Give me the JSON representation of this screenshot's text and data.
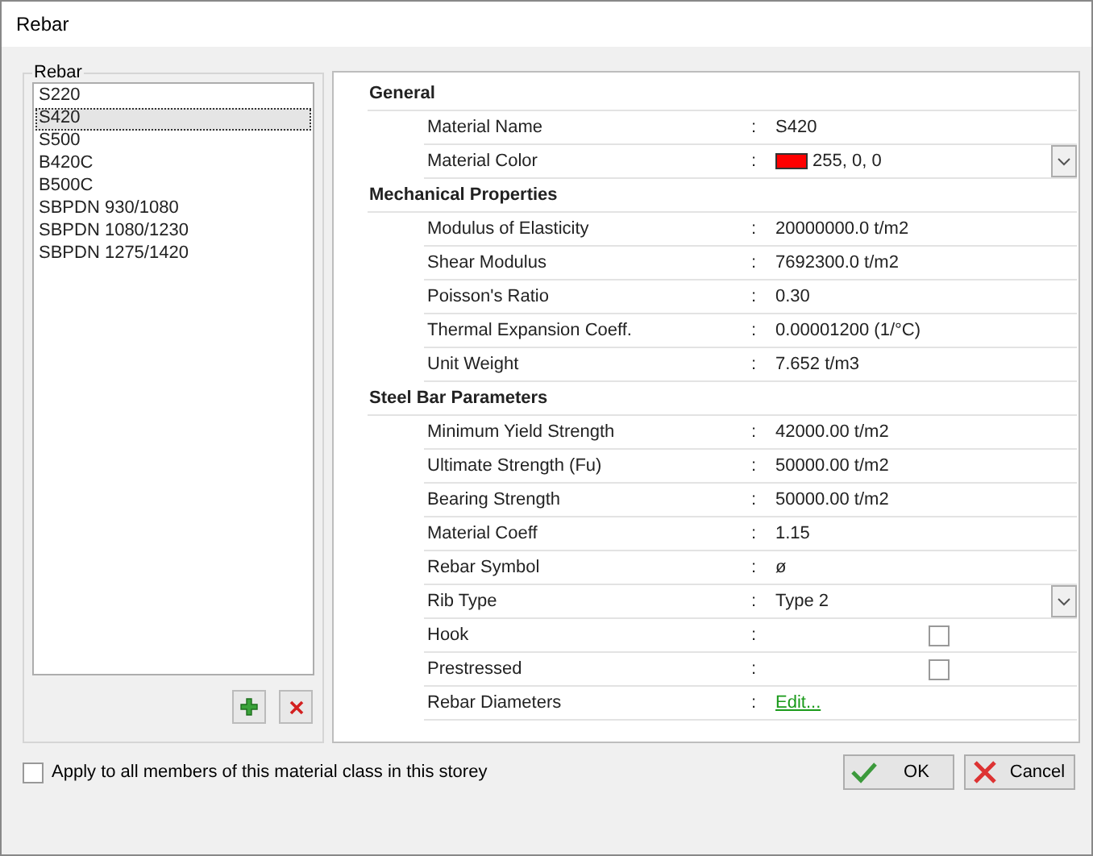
{
  "window": {
    "title": "Rebar"
  },
  "rebar_list": {
    "label": "Rebar",
    "items": [
      {
        "name": "S220",
        "selected": false
      },
      {
        "name": "S420",
        "selected": true
      },
      {
        "name": "S500",
        "selected": false
      },
      {
        "name": "B420C",
        "selected": false
      },
      {
        "name": "B500C",
        "selected": false
      },
      {
        "name": "SBPDN 930/1080",
        "selected": false
      },
      {
        "name": "SBPDN 1080/1230",
        "selected": false
      },
      {
        "name": "SBPDN 1275/1420",
        "selected": false
      }
    ]
  },
  "properties": {
    "sections": [
      {
        "title": "General",
        "rows": [
          {
            "kind": "text",
            "label": "Material Name",
            "separator": ":",
            "value": "S420"
          },
          {
            "kind": "color",
            "label": "Material Color",
            "separator": ":",
            "value": "255, 0, 0",
            "color": "#ff0000"
          }
        ]
      },
      {
        "title": "Mechanical Properties",
        "rows": [
          {
            "kind": "text",
            "label": "Modulus of Elasticity",
            "separator": ":",
            "value": "20000000.0  t/m2"
          },
          {
            "kind": "text",
            "label": "Shear Modulus",
            "separator": ":",
            "value": "7692300.0  t/m2"
          },
          {
            "kind": "text",
            "label": "Poisson's Ratio",
            "separator": ":",
            "value": "0.30"
          },
          {
            "kind": "text",
            "label": "Thermal Expansion Coeff.",
            "separator": ":",
            "value": "0.00001200  (1/°C)"
          },
          {
            "kind": "text",
            "label": "Unit Weight",
            "separator": ":",
            "value": "7.652  t/m3"
          }
        ]
      },
      {
        "title": "Steel Bar Parameters",
        "rows": [
          {
            "kind": "text",
            "label": "Minimum Yield Strength",
            "separator": ":",
            "value": "42000.00  t/m2"
          },
          {
            "kind": "text",
            "label": "Ultimate Strength (Fu)",
            "separator": ":",
            "value": "50000.00  t/m2"
          },
          {
            "kind": "text",
            "label": "Bearing Strength",
            "separator": ":",
            "value": "50000.00  t/m2"
          },
          {
            "kind": "text",
            "label": "Material Coeff",
            "separator": ":",
            "value": "1.15"
          },
          {
            "kind": "text",
            "label": "Rebar Symbol",
            "separator": ":",
            "value": "ø"
          },
          {
            "kind": "dropdown",
            "label": "Rib Type",
            "separator": ":",
            "value": "Type 2"
          },
          {
            "kind": "checkbox",
            "label": "Hook",
            "separator": ":",
            "checked": false
          },
          {
            "kind": "checkbox",
            "label": "Prestressed",
            "separator": ":",
            "checked": false
          },
          {
            "kind": "link",
            "label": "Rebar Diameters",
            "separator": ":",
            "value": "Edit..."
          }
        ]
      }
    ]
  },
  "apply_all": {
    "label": "Apply to all members of this material class in this storey",
    "checked": false
  },
  "buttons": [
    {
      "kind": "ok",
      "label": "OK"
    },
    {
      "kind": "cancel",
      "label": "Cancel"
    }
  ]
}
